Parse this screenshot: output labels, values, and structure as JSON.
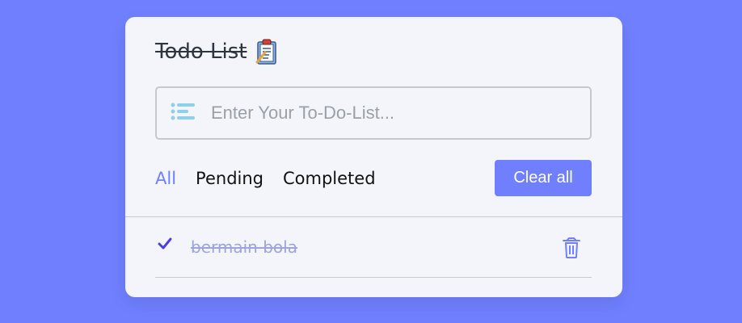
{
  "header": {
    "title": "Todo List",
    "title_icon": "clipboard-icon"
  },
  "input": {
    "placeholder": "Enter Your To-Do-List...",
    "value": "",
    "icon": "list-icon"
  },
  "filters": {
    "items": [
      {
        "label": "All",
        "active": true
      },
      {
        "label": "Pending",
        "active": false
      },
      {
        "label": "Completed",
        "active": false
      }
    ]
  },
  "actions": {
    "clear_label": "Clear all"
  },
  "tasks": [
    {
      "label": "bermain bola",
      "completed": true
    }
  ],
  "colors": {
    "background": "#6f7ffe",
    "accent": "#6f7ffe",
    "card": "#f4f5fa",
    "completed_text": "#9ea4dd"
  }
}
